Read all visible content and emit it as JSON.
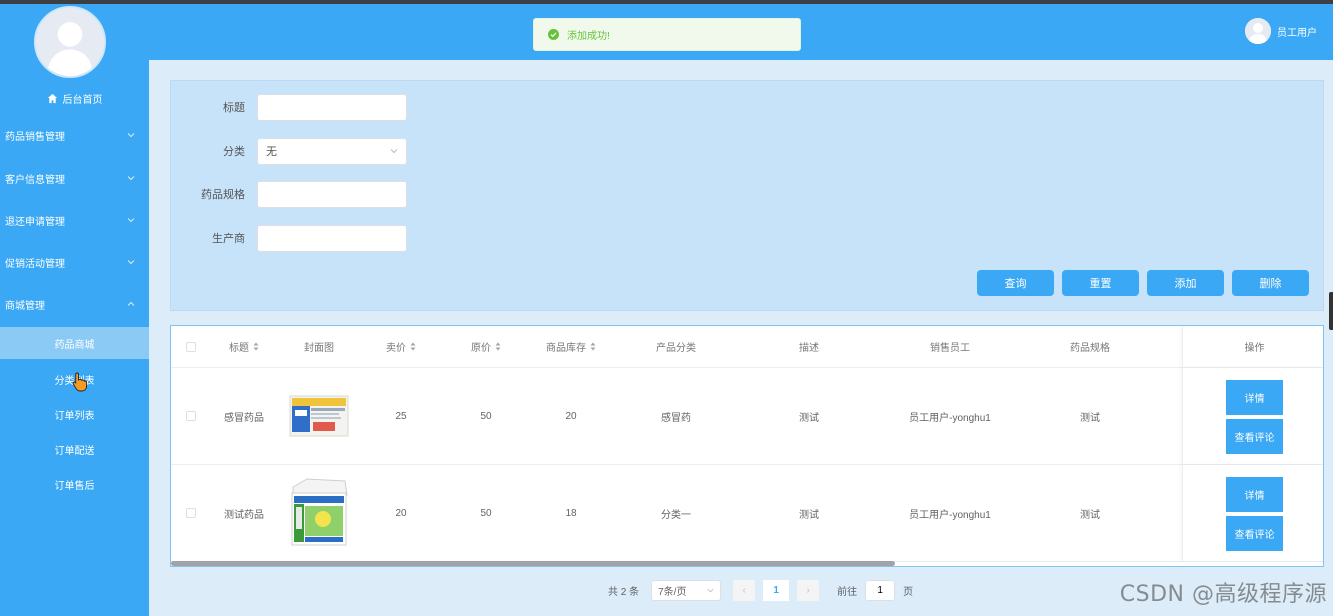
{
  "sidebar": {
    "home_label": "后台首页",
    "groups": [
      {
        "label": "药品销售管理"
      },
      {
        "label": "客户信息管理"
      },
      {
        "label": "退还申请管理"
      },
      {
        "label": "促销活动管理"
      },
      {
        "label": "商城管理"
      }
    ],
    "sub_items": [
      {
        "label": "药品商城",
        "active": true
      },
      {
        "label": "分类列表"
      },
      {
        "label": "订单列表"
      },
      {
        "label": "订单配送"
      },
      {
        "label": "订单售后"
      }
    ]
  },
  "header": {
    "toast": "添加成功!",
    "user_name": "员工用户"
  },
  "search": {
    "title_label": "标题",
    "category_label": "分类",
    "category_value": "无",
    "spec_label": "药品规格",
    "maker_label": "生产商",
    "buttons": {
      "query": "查询",
      "reset": "重置",
      "add": "添加",
      "delete": "删除"
    }
  },
  "table": {
    "headers": [
      "标题",
      "封面图",
      "卖价",
      "原价",
      "商品库存",
      "产品分类",
      "描述",
      "销售员工",
      "药品规格",
      "操作"
    ],
    "rows": [
      {
        "title": "感冒药品",
        "price": "25",
        "orig_price": "50",
        "stock": "20",
        "category": "感冒药",
        "desc": "测试",
        "staff": "员工用户-yonghu1",
        "spec": "测试"
      },
      {
        "title": "测试药品",
        "price": "20",
        "orig_price": "50",
        "stock": "18",
        "category": "分类一",
        "desc": "测试",
        "staff": "员工用户-yonghu1",
        "spec": "测试"
      }
    ],
    "detail_label": "详情",
    "comment_label": "查看评论"
  },
  "pagination": {
    "total": "共 2 条",
    "page_size": "7条/页",
    "current": "1",
    "prev": "‹",
    "next": "›",
    "goto_prefix": "前往",
    "goto_value": "1",
    "goto_suffix": "页"
  },
  "watermark": "CSDN @高级程序源",
  "colors": {
    "primary": "#3aa8f4",
    "success": "#67c23a"
  }
}
